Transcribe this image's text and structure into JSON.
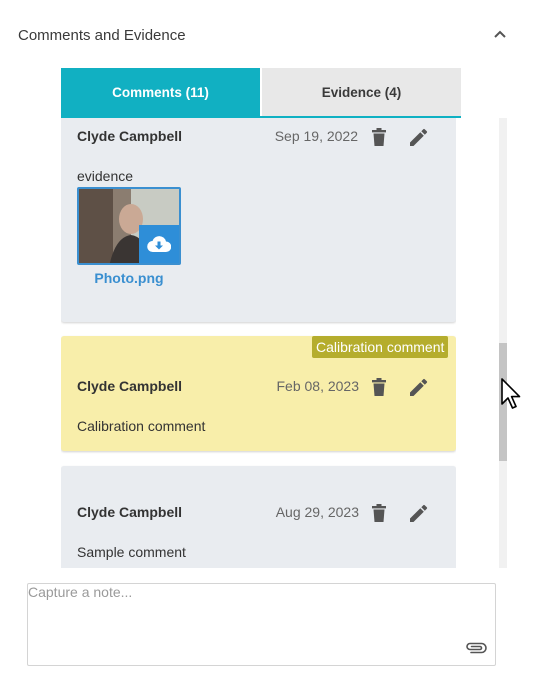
{
  "section": {
    "title": "Comments and Evidence"
  },
  "tabs": [
    {
      "label": "Comments (11)"
    },
    {
      "label": "Evidence (4)"
    }
  ],
  "comments": [
    {
      "author": "Clyde Campbell",
      "date": "Sep 19, 2022",
      "text": "evidence",
      "attachment": {
        "name": "Photo.png"
      }
    },
    {
      "badge": "Calibration comment",
      "author": "Clyde Campbell",
      "date": "Feb 08, 2023",
      "text": "Calibration comment"
    },
    {
      "author": "Clyde Campbell",
      "date": "Aug 29, 2023",
      "text": "Sample comment"
    }
  ],
  "note": {
    "placeholder": "Capture a note..."
  },
  "colors": {
    "accent": "#11b0c2",
    "link": "#3a8fd0",
    "calibration_bg": "#f8eeaa",
    "calibration_badge": "#b5ad2d"
  }
}
